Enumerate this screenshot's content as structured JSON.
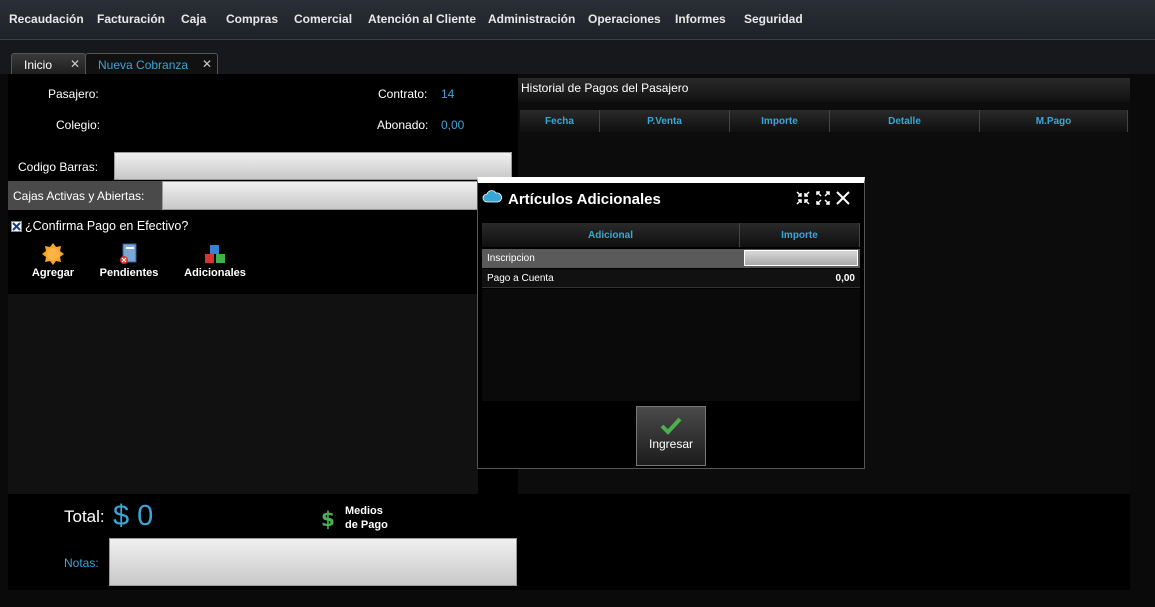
{
  "menu": [
    "Recaudación",
    "Facturación",
    "Caja",
    "Compras",
    "Comercial",
    "Atención al Cliente",
    "Administración",
    "Operaciones",
    "Informes",
    "Seguridad"
  ],
  "tabs": [
    {
      "label": "Inicio",
      "active": false
    },
    {
      "label": "Nueva Cobranza",
      "active": true
    }
  ],
  "form": {
    "pasajero_label": "Pasajero:",
    "colegio_label": "Colegio:",
    "contrato_label": "Contrato:",
    "contrato_value": "14",
    "abonado_label": "Abonado:",
    "abonado_value": "0,00",
    "codigo_label": "Codigo Barras:",
    "cajas_label": "Cajas Activas y Abiertas:",
    "confirma_label": "¿Confirma Pago en Efectivo?",
    "confirma_checked": true
  },
  "actions": [
    {
      "label": "Agregar",
      "icon": "star-burst-icon"
    },
    {
      "label": "Pendientes",
      "icon": "document-cancel-icon"
    },
    {
      "label": "Adicionales",
      "icon": "blocks-icon"
    }
  ],
  "historial": {
    "title": "Historial de Pagos del Pasajero",
    "columns": [
      "Fecha",
      "P.Venta",
      "Importe",
      "Detalle",
      "M.Pago"
    ]
  },
  "bottom": {
    "total_label": "Total:",
    "total_value": "$ 0",
    "medios_line1": "Medios",
    "medios_line2": "de Pago",
    "notas_label": "Notas:"
  },
  "modal": {
    "title": "Artículos Adicionales",
    "columns": [
      "Adicional",
      "Importe"
    ],
    "rows": [
      {
        "adicional": "Inscripcion",
        "importe": ""
      },
      {
        "adicional": "Pago a Cuenta",
        "importe": "0,00"
      }
    ],
    "submit_label": "Ingresar"
  },
  "colors": {
    "accent": "#3aa6d6",
    "success": "#4caf50"
  }
}
